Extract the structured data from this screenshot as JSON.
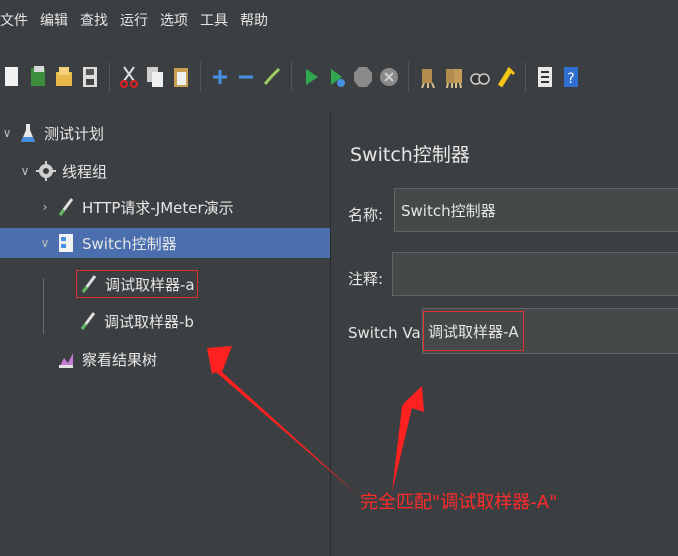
{
  "menu": [
    "文件",
    "编辑",
    "查找",
    "运行",
    "选项",
    "工具",
    "帮助"
  ],
  "toolbar_icons": [
    "new-icon",
    "templates-icon",
    "open-icon",
    "save-icon",
    "cut-icon",
    "copy-icon",
    "paste-icon",
    "expand-icon",
    "collapse-icon",
    "toggle-icon",
    "start-icon",
    "start-no-pause-icon",
    "stop-icon",
    "shutdown-icon",
    "clear-icon",
    "clear-all-icon",
    "search-icon",
    "reset-search-icon",
    "function-helper-icon",
    "help-icon"
  ],
  "tree": {
    "test_plan": "测试计划",
    "thread_group": "线程组",
    "http_request": "HTTP请求-JMeter演示",
    "switch_controller": "Switch控制器",
    "sampler_a": "调试取样器-a",
    "sampler_b": "调试取样器-b",
    "result_tree": "察看结果树"
  },
  "panel": {
    "title": "Switch控制器",
    "name_label": "名称:",
    "name_value": "Switch控制器",
    "comment_label": "注释:",
    "comment_value": "",
    "switch_label": "Switch Value",
    "switch_value": "调试取样器-A"
  },
  "annotation": "完全匹配\"调试取样器-A\"",
  "colors": {
    "selected_row": "#4b6eaf",
    "highlight": "#e03030",
    "background": "#3c3f41"
  }
}
